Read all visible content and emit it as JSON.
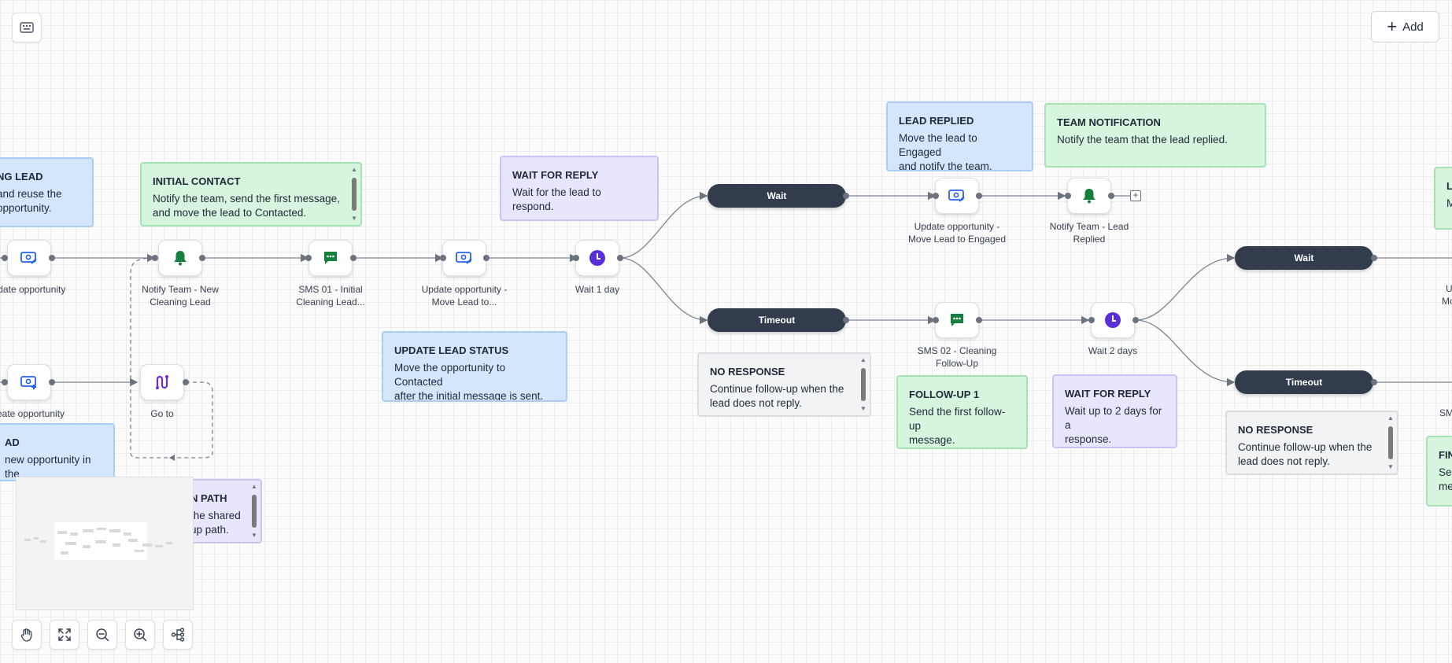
{
  "toolbar": {
    "add_label": "Add",
    "add_icon": "plus-icon",
    "keyboard_icon": "keyboard-icon"
  },
  "notes": [
    {
      "id": "existing-lead",
      "title": "NG LEAD",
      "body": "and reuse the\nopportunity.",
      "color": "blue"
    },
    {
      "id": "initial-contact",
      "title": "INITIAL CONTACT",
      "body": "Notify the team, send the first message,\nand move the lead to Contacted.",
      "color": "green"
    },
    {
      "id": "wait-for-reply-1",
      "title": "WAIT FOR REPLY",
      "body": "Wait for the lead to respond.",
      "color": "purple"
    },
    {
      "id": "lead-replied",
      "title": "LEAD REPLIED",
      "body": "Move the lead to Engaged\nand notify the team.",
      "color": "blue"
    },
    {
      "id": "team-notification",
      "title": "TEAM NOTIFICATION",
      "body": "Notify the team that the lead replied.",
      "color": "green"
    },
    {
      "id": "update-lead-status",
      "title": "UPDATE LEAD STATUS",
      "body": "Move the opportunity to Contacted\nafter the initial message is sent.",
      "color": "blue"
    },
    {
      "id": "no-response-1",
      "title": "NO RESPONSE",
      "body": "Continue follow-up when the\nlead does not reply.",
      "color": "gray"
    },
    {
      "id": "follow-up-1",
      "title": "FOLLOW-UP 1",
      "body": "Send the first follow-up\nmessage.",
      "color": "green"
    },
    {
      "id": "wait-for-reply-2",
      "title": "WAIT FOR REPLY",
      "body": "Wait up to 2 days for a\nresponse.",
      "color": "purple"
    },
    {
      "id": "no-response-2",
      "title": "NO RESPONSE",
      "body": "Continue follow-up when the\nlead does not reply.",
      "color": "gray"
    },
    {
      "id": "new-lead",
      "title": "AD",
      "body": "new opportunity in the\nLeads pipeline.",
      "color": "blue"
    },
    {
      "id": "main-path",
      "title": "N PATH",
      "body": "the shared\nup path.",
      "color": "purple"
    },
    {
      "id": "edge-l",
      "title": "L",
      "body": "M",
      "color": "green"
    },
    {
      "id": "edge-fin",
      "title": "FIN",
      "body": "Se\nme",
      "color": "green"
    }
  ],
  "nodes": [
    {
      "id": "update-opportunity",
      "label": "pdate opportunity",
      "icon": "opportunity-icon"
    },
    {
      "id": "notify-team-new",
      "label": "Notify Team - New\nCleaning Lead",
      "icon": "bell-icon"
    },
    {
      "id": "sms-01",
      "label": "SMS 01 - Initial\nCleaning Lead...",
      "icon": "message-icon"
    },
    {
      "id": "update-opp-move",
      "label": "Update opportunity -\nMove Lead to...",
      "icon": "opportunity-icon"
    },
    {
      "id": "wait-1-day",
      "label": "Wait 1 day",
      "icon": "clock-icon"
    },
    {
      "id": "update-opp-engaged",
      "label": "Update opportunity -\nMove Lead to Engaged",
      "icon": "opportunity-icon"
    },
    {
      "id": "notify-team-replied",
      "label": "Notify Team - Lead\nReplied",
      "icon": "bell-icon"
    },
    {
      "id": "sms-02",
      "label": "SMS 02 - Cleaning\nFollow-Up",
      "icon": "message-icon"
    },
    {
      "id": "wait-2-days",
      "label": "Wait 2 days",
      "icon": "clock-icon"
    },
    {
      "id": "create-opportunity",
      "label": "reate opportunity",
      "icon": "opportunity-add-icon"
    },
    {
      "id": "go-to",
      "label": "Go to",
      "icon": "goto-icon"
    }
  ],
  "pills": [
    {
      "id": "wait-a",
      "label": "Wait"
    },
    {
      "id": "timeout-a",
      "label": "Timeout"
    },
    {
      "id": "wait-b",
      "label": "Wait"
    },
    {
      "id": "timeout-b",
      "label": "Timeout"
    }
  ],
  "edge_captions": {
    "up": "U",
    "mo": "Mo",
    "sm": "SM"
  },
  "controls": [
    "pan-hand-icon",
    "fit-view-icon",
    "zoom-out-icon",
    "zoom-in-icon",
    "auto-layout-icon"
  ]
}
